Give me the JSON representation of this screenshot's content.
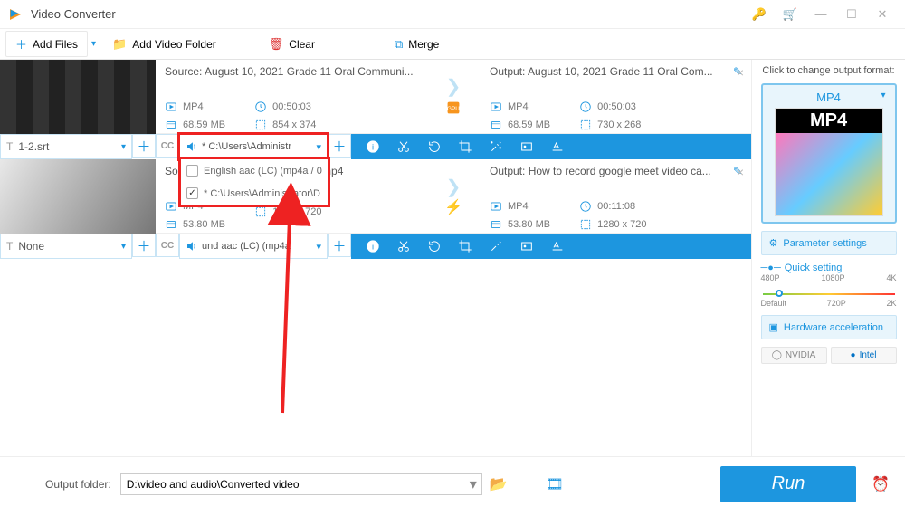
{
  "app": {
    "title": "Video Converter"
  },
  "toolbar": {
    "add_files": "Add Files",
    "add_folder": "Add Video Folder",
    "clear": "Clear",
    "merge": "Merge"
  },
  "items": [
    {
      "src_title": "Source: August 10, 2021 Grade 11 Oral Communi...",
      "out_title": "Output: August 10, 2021 Grade 11 Oral Com...",
      "src_fmt": "MP4",
      "src_dur": "00:50:03",
      "src_size": "68.59 MB",
      "src_res": "854 x 374",
      "out_fmt": "MP4",
      "out_dur": "00:50:03",
      "out_size": "68.59 MB",
      "out_res": "730 x 268",
      "sub": "1-2.srt",
      "aud": "* C:\\Users\\Administr",
      "gpu": "GPU",
      "aud_opts": [
        {
          "checked": false,
          "label": "English aac (LC) (mp4a / 0"
        },
        {
          "checked": true,
          "label": "* C:\\Users\\Administrator\\D"
        }
      ]
    },
    {
      "src_title": "Source: Ho",
      "src_overflow_text": "II.mp4",
      "out_title": "Output: How to record google meet video ca...",
      "src_fmt": "MP4",
      "src_dur": "",
      "src_size": "53.80 MB",
      "src_res": "1280 x 720",
      "out_fmt": "MP4",
      "out_dur": "00:11:08",
      "out_size": "53.80 MB",
      "out_res": "1280 x 720",
      "sub": "None",
      "aud": "und aac (LC) (mp4a"
    }
  ],
  "right": {
    "change_fmt": "Click to change output format:",
    "fmt": "MP4",
    "param": "Parameter settings",
    "quick": "Quick setting",
    "q_top": [
      "480P",
      "1080P",
      "4K"
    ],
    "q_bot": [
      "Default",
      "720P",
      "2K"
    ],
    "hw": "Hardware acceleration",
    "nvidia": "NVIDIA",
    "intel": "Intel"
  },
  "bottom": {
    "label": "Output folder:",
    "path": "D:\\video and audio\\Converted video",
    "run": "Run"
  }
}
